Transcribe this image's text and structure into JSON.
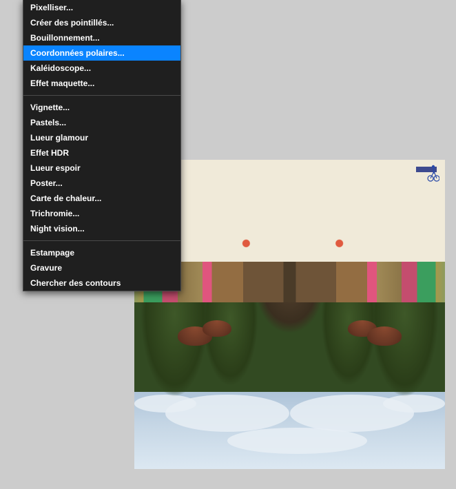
{
  "menu": {
    "groups": [
      {
        "items": [
          {
            "label": "Pixelliser...",
            "highlighted": false
          },
          {
            "label": "Créer des pointillés...",
            "highlighted": false
          },
          {
            "label": "Bouillonnement...",
            "highlighted": false
          },
          {
            "label": "Coordonnées polaires...",
            "highlighted": true
          },
          {
            "label": "Kaléidoscope...",
            "highlighted": false
          },
          {
            "label": "Effet maquette...",
            "highlighted": false
          }
        ]
      },
      {
        "items": [
          {
            "label": "Vignette...",
            "highlighted": false
          },
          {
            "label": "Pastels...",
            "highlighted": false
          },
          {
            "label": "Lueur glamour",
            "highlighted": false
          },
          {
            "label": "Effet HDR",
            "highlighted": false
          },
          {
            "label": "Lueur espoir",
            "highlighted": false
          },
          {
            "label": "Poster...",
            "highlighted": false
          },
          {
            "label": "Carte de chaleur...",
            "highlighted": false
          },
          {
            "label": "Trichromie...",
            "highlighted": false
          },
          {
            "label": "Night vision...",
            "highlighted": false
          }
        ]
      },
      {
        "items": [
          {
            "label": "Estampage",
            "highlighted": false
          },
          {
            "label": "Gravure",
            "highlighted": false
          },
          {
            "label": "Chercher des contours",
            "highlighted": false
          }
        ]
      }
    ]
  }
}
